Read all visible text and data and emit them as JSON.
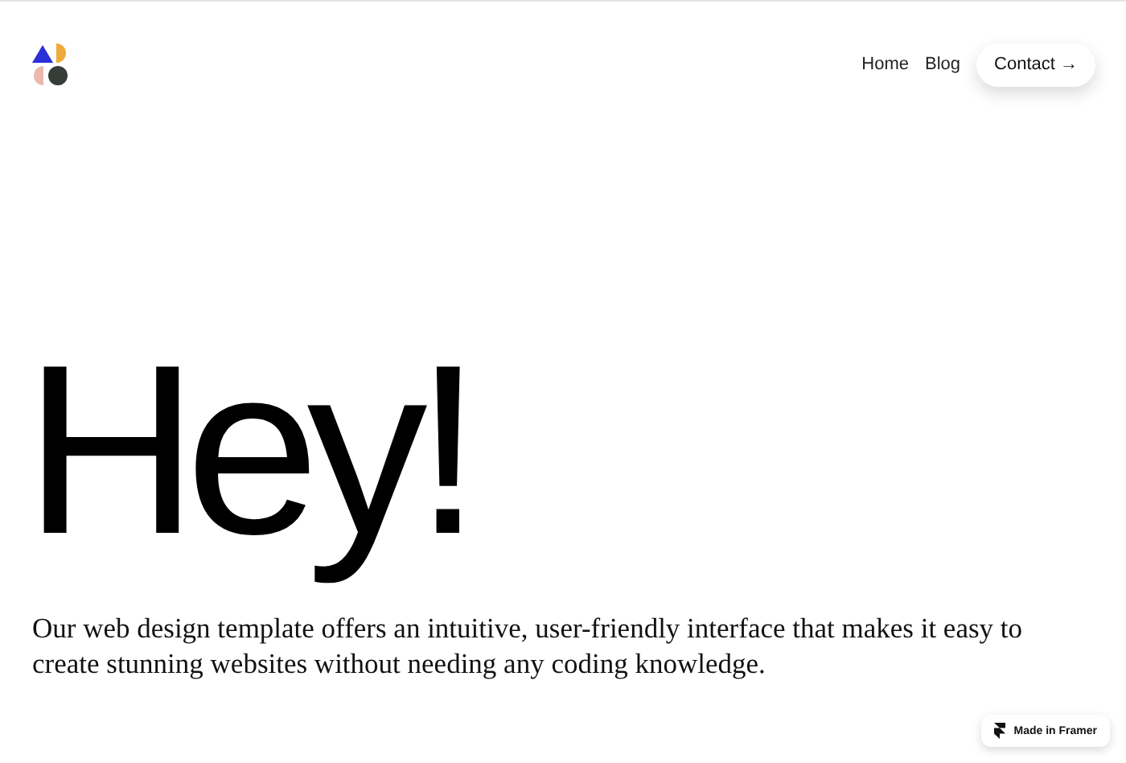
{
  "nav": {
    "links": [
      {
        "label": "Home"
      },
      {
        "label": "Blog"
      }
    ],
    "cta": {
      "label": "Contact",
      "arrow": "→"
    }
  },
  "hero": {
    "heading": "Hey!",
    "text": "Our web design template offers an intuitive, user-friendly interface that makes it easy to create stunning websites without needing any coding knowledge."
  },
  "badge": {
    "label": "Made in Framer"
  }
}
